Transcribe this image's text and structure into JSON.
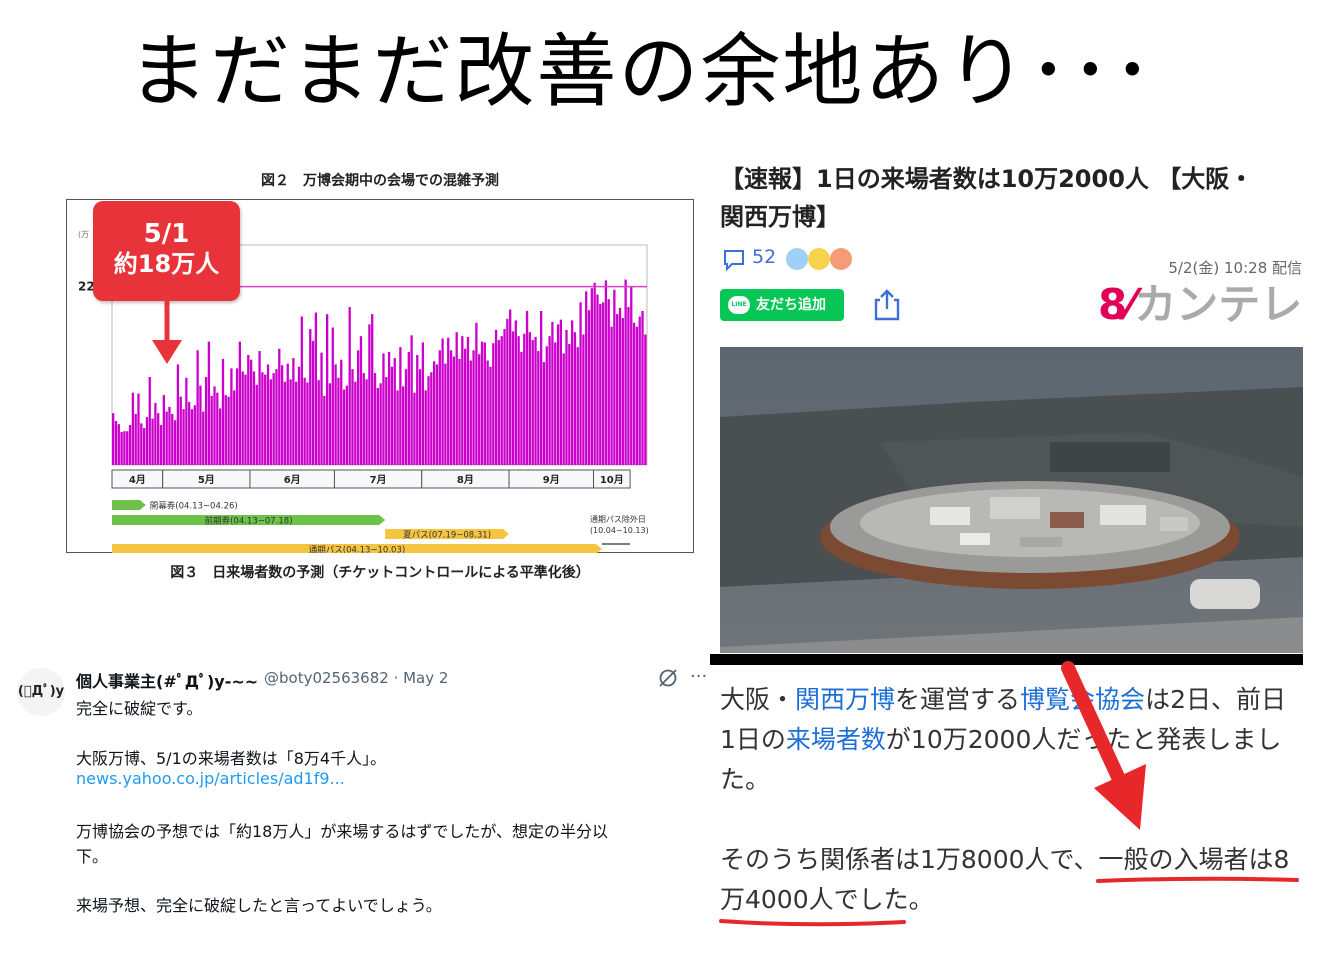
{
  "slide": {
    "title": "まだまだ改善の余地あり･･･"
  },
  "chart_panel": {
    "fig2_caption": "図２　万博会期中の会場での混雑予測",
    "fig3_caption": "図３　日来場者数の予測（チケットコントロールによる平準化後）",
    "callout": {
      "date": "5/1",
      "value": "約18万人"
    }
  },
  "chart_data": {
    "type": "bar",
    "title": "",
    "xlabel": "",
    "ylabel": "",
    "y_unit_label": "(万",
    "reference_line": {
      "value": 22.7,
      "label": "22.7",
      "color": "#e040c0"
    },
    "ylim": [
      0,
      28
    ],
    "bar_color": "#cc00cc",
    "months": [
      "4月",
      "5月",
      "6月",
      "7月",
      "8月",
      "9月",
      "10月"
    ],
    "month_days": [
      18,
      31,
      30,
      31,
      31,
      30,
      13
    ],
    "values": [
      6.6,
      5.6,
      5.2,
      4.2,
      4.3,
      4.3,
      5.1,
      9.2,
      6.5,
      9.1,
      5.3,
      4.7,
      6.1,
      11.2,
      5.9,
      7.9,
      6.6,
      5.1,
      8.9,
      6.8,
      7.4,
      6.5,
      5.7,
      12.8,
      8.7,
      7.1,
      11.1,
      8.0,
      7.1,
      7.6,
      14.6,
      10.1,
      6.8,
      11.2,
      15.7,
      8.8,
      10.0,
      9.2,
      7.2,
      13.5,
      8.9,
      8.7,
      12.3,
      9.5,
      12.3,
      15.7,
      11.9,
      11.5,
      14.0,
      13.4,
      11.9,
      10.2,
      14.5,
      11.8,
      11.5,
      12.8,
      10.9,
      11.7,
      12.2,
      14.8,
      12.7,
      10.6,
      12.9,
      10.9,
      13.6,
      10.6,
      12.5,
      18.9,
      11.1,
      10.5,
      17.3,
      15.8,
      19.4,
      10.8,
      14.3,
      8.8,
      19.2,
      10.4,
      17.5,
      12.8,
      11.1,
      13.4,
      9.6,
      10.1,
      20.1,
      12.2,
      10.6,
      14.6,
      16.4,
      11.7,
      10.9,
      17.9,
      19.2,
      11.7,
      9.8,
      10.4,
      14.2,
      11.2,
      14.4,
      12.5,
      13.6,
      9.5,
      15.0,
      10.0,
      12.2,
      14.4,
      16.5,
      9.2,
      14.0,
      12.2,
      15.6,
      9.5,
      11.3,
      11.8,
      13.2,
      12.8,
      14.6,
      16.1,
      12.9,
      16.2,
      14.6,
      13.8,
      16.9,
      13.5,
      16.4,
      14.8,
      16.3,
      13.3,
      14.6,
      18.1,
      14.1,
      15.7,
      15.6,
      13.3,
      12.5,
      15.5,
      17.2,
      15.9,
      16.4,
      17.3,
      18.6,
      19.8,
      17.0,
      18.4,
      16.4,
      14.4,
      16.7,
      19.6,
      16.9,
      15.9,
      16.3,
      14.5,
      19.6,
      13.1,
      15.1,
      16.4,
      18.2,
      15.6,
      17.9,
      18.5,
      14.2,
      17.2,
      15.4,
      18.4,
      16.9,
      15.0,
      20.7,
      16.6,
      22.1,
      19.7,
      22.5,
      23.2,
      21.7,
      20.5,
      20.7,
      23.5,
      21.1,
      17.6,
      22.3,
      19.2,
      20.0,
      18.7,
      23.6,
      20.1,
      22.7,
      18.1,
      17.6,
      18.9,
      19.6,
      16.6
    ],
    "ticket_bars": [
      {
        "label": "開幕券(04.13~04.26)",
        "color": "#6cc24a",
        "start": 0,
        "end": 11
      },
      {
        "label": "前期券(04.13~07.18)",
        "color": "#6cc24a",
        "start": 0,
        "end": 96
      },
      {
        "label": "夏パス(07.19~08.31)",
        "color": "#f5c542",
        "start": 97,
        "end": 140
      },
      {
        "label": "通期パス(04.13~10.03)",
        "color": "#f5c542",
        "start": 0,
        "end": 173
      },
      {
        "label": "通期パス除外日 (10.04~10.13)",
        "color": "#555555",
        "start": 174,
        "end": 183
      }
    ]
  },
  "tweet": {
    "avatar_text": "(ﾟДﾟ)y",
    "author": "個人事業主(#ﾟДﾟ)y-~~",
    "handle": "@boty02563682 · May 2",
    "more": "···",
    "lines": [
      "完全に破綻です。",
      "大阪万博、5/1の来場者数は「8万4千人」。",
      "万博協会の予想では「約18万人」が来場するはずでしたが、想定の半分以",
      "下。",
      "来場予想、完全に破綻したと言ってよいでしょう。"
    ],
    "link": "news.yahoo.co.jp/articles/ad1f9..."
  },
  "news": {
    "headline_1": "【速報】1日の来場者数は10万2000人 【大阪・",
    "headline_2": "関西万博】",
    "comment_count": "52",
    "date": "5/2(金) 10:28 配信",
    "line_button": "友だち追加",
    "line_badge": "LINE",
    "brand_8": "8",
    "brand_slash": "⁄",
    "brand_text": "カンテレ",
    "colors": {
      "link": "#1d6fd8",
      "line_green": "#06c755",
      "brand_red": "#e0005a",
      "annotation_red": "#e8272b"
    },
    "body": {
      "p1_l1_a": "大阪・",
      "p1_l1_b": "関西万博",
      "p1_l1_c": "を運営する",
      "p1_l1_d": "博覧会協会",
      "p1_l1_e": "は2日、前日",
      "p1_l2_a": "1日の",
      "p1_l2_b": "来場者数",
      "p1_l2_c": "が10万2000人だったと発表しまし",
      "p1_l3": "た。",
      "p2_l1": "そのうち関係者は1万8000人で、一般の入場者は8",
      "p2_l2": "万4000人でした。"
    }
  }
}
